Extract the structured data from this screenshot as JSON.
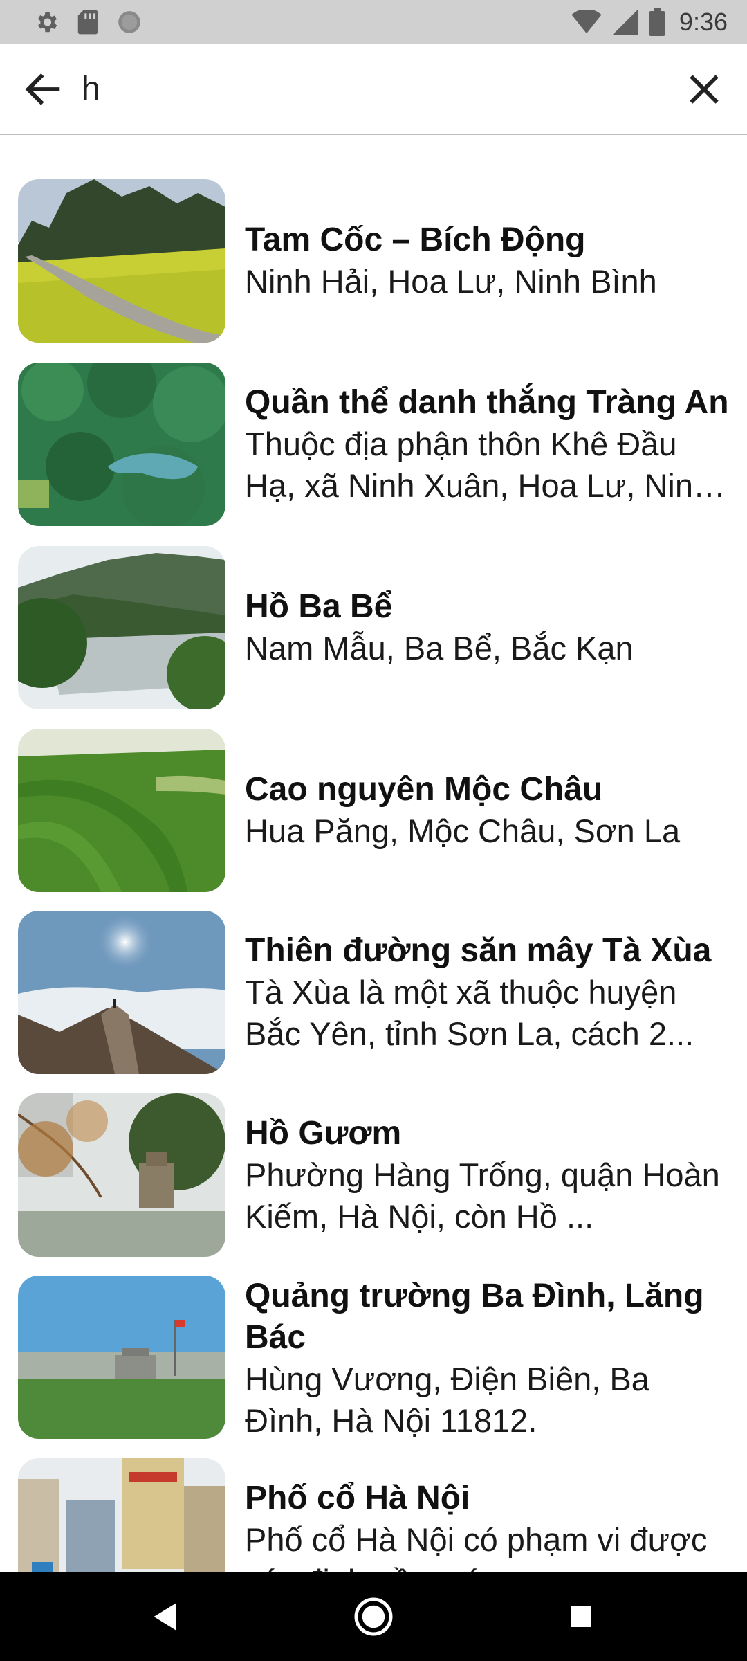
{
  "status_bar": {
    "time": "9:36",
    "icons_left": [
      "settings-icon",
      "sd-card-icon",
      "circle-icon"
    ],
    "icons_right": [
      "wifi-icon",
      "signal-icon",
      "battery-icon"
    ]
  },
  "search": {
    "value": "h",
    "back_icon": "arrow-left-icon",
    "clear_icon": "close-icon"
  },
  "results": [
    {
      "title": "Tam Cốc – Bích Động",
      "subtitle": "Ninh Hải, Hoa Lư, Ninh Bình",
      "image": "rice-field-river"
    },
    {
      "title": "Quần thể danh thắng Tràng An",
      "subtitle": "Thuộc địa phận thôn Khê Đầu Hạ, xã Ninh Xuân, Hoa Lư, Ninh Bình",
      "image": "aerial-green-hills"
    },
    {
      "title": "Hồ Ba Bể",
      "subtitle": "Nam Mẫu, Ba Bể, Bắc Kạn",
      "image": "lake-mountains"
    },
    {
      "title": "Cao nguyên Mộc Châu",
      "subtitle": "Hua Păng, Mộc Châu, Sơn La",
      "image": "tea-hills"
    },
    {
      "title": "Thiên đường săn mây Tà Xùa",
      "subtitle": "Tà Xùa là một xã thuộc huyện Bắc Yên, tỉnh Sơn La, cách 2...",
      "image": "sea-of-clouds"
    },
    {
      "title": "Hồ Gươm",
      "subtitle": "Phường Hàng Trống, quận Hoàn Kiếm, Hà Nội, còn Hồ ...",
      "image": "turtle-tower-lake"
    },
    {
      "title": "Quảng trường Ba Đình, Lăng Bác",
      "subtitle": "Hùng Vương, Điện Biên, Ba Đình, Hà Nội 11812.",
      "image": "ba-dinh-square"
    },
    {
      "title": "Phố cổ Hà Nội",
      "subtitle": "Phố cổ Hà Nội có phạm vi được xác định gồm các...",
      "image": "old-quarter-street"
    }
  ],
  "nav_bar": {
    "icons": [
      "back-triangle-icon",
      "home-circle-icon",
      "recents-square-icon"
    ]
  }
}
